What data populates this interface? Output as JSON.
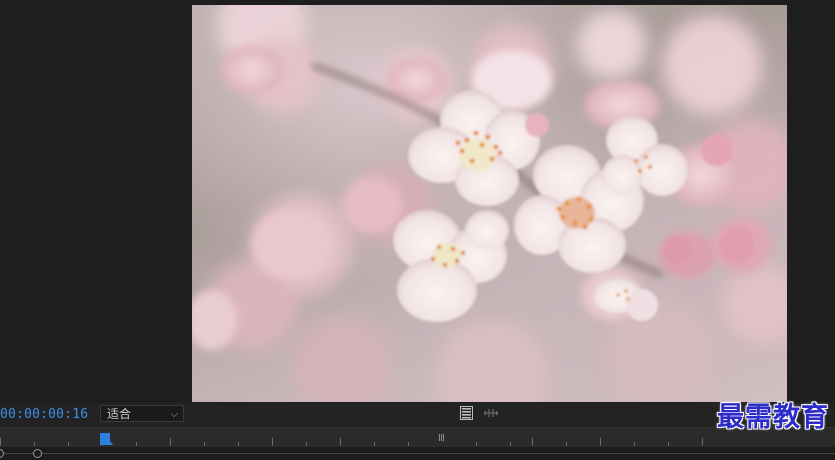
{
  "program_monitor": {
    "timecode": "00:00:00:16",
    "zoom": {
      "selected": "适合"
    },
    "icons": {
      "settings": "settings-icon",
      "split_view": "compare-view-icon",
      "zoom_chevron": "chevron-down-icon",
      "playhead": "playhead-icon"
    },
    "frame_content": "cherry-blossom-photo"
  },
  "watermark": {
    "text": "最需教育"
  },
  "colors": {
    "timecode": "#3d8fe8",
    "playhead": "#2d7fe0",
    "panel_bg": "#232323",
    "watermark": "#2e2cc9"
  }
}
